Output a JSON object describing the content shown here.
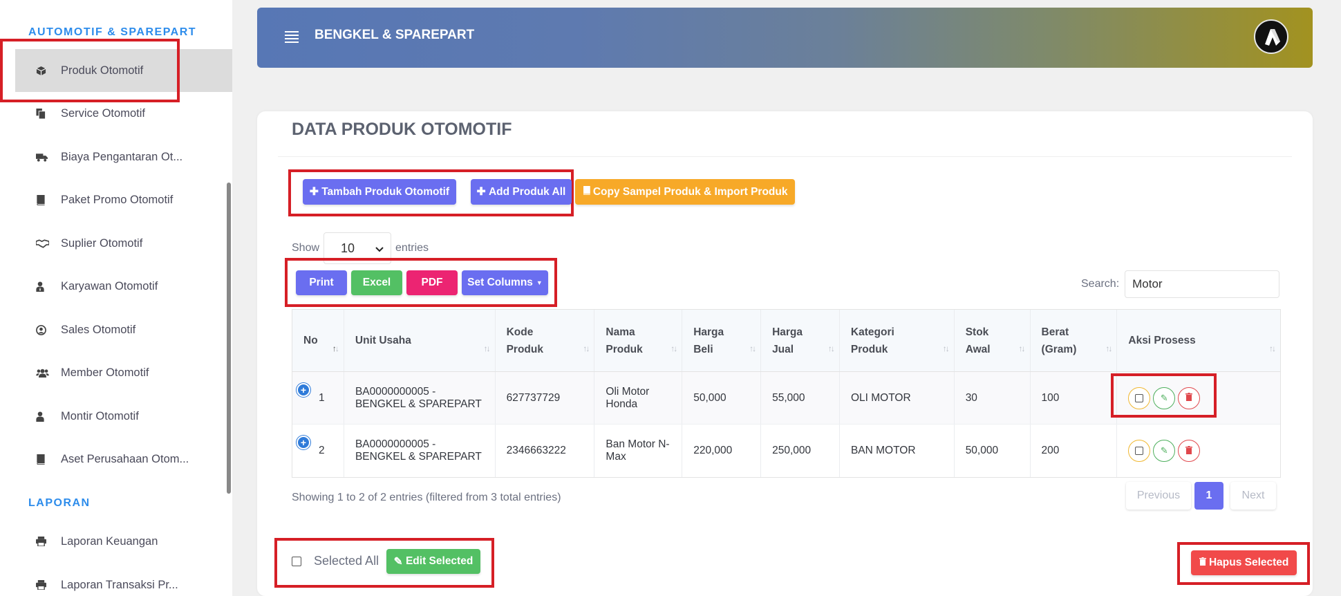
{
  "sidebar": {
    "section1": "AUTOMOTIF & SPAREPART",
    "items": [
      {
        "label": "Produk Otomotif",
        "icon": "box-icon"
      },
      {
        "label": "Service Otomotif",
        "icon": "copy-icon"
      },
      {
        "label": "Biaya Pengantaran Ot...",
        "icon": "truck-icon"
      },
      {
        "label": "Paket Promo Otomotif",
        "icon": "book-icon"
      },
      {
        "label": "Suplier Otomotif",
        "icon": "handshake-icon"
      },
      {
        "label": "Karyawan Otomotif",
        "icon": "user-tie-icon"
      },
      {
        "label": "Sales Otomotif",
        "icon": "user-circle-icon"
      },
      {
        "label": "Member Otomotif",
        "icon": "users-icon"
      },
      {
        "label": "Montir Otomotif",
        "icon": "user-icon"
      },
      {
        "label": "Aset Perusahaan Otom...",
        "icon": "book-icon"
      }
    ],
    "section2": "LAPORAN",
    "report_items": [
      {
        "label": "Laporan Keuangan",
        "icon": "print-icon"
      },
      {
        "label": "Laporan Transaksi Pr...",
        "icon": "print-icon"
      }
    ]
  },
  "header": {
    "brand": "BENGKEL & SPAREPART"
  },
  "page": {
    "title": "DATA PRODUK OTOMOTIF",
    "btn_tambah": "Tambah Produk Otomotif",
    "btn_add_all": "Add Produk All",
    "btn_copy": "Copy Sampel Produk & Import Produk",
    "show_label": "Show",
    "entries_value": "10",
    "entries_label": "entries",
    "btn_print": "Print",
    "btn_excel": "Excel",
    "btn_pdf": "PDF",
    "btn_columns": "Set Columns",
    "search_label": "Search:",
    "search_value": "Motor"
  },
  "table": {
    "headers": {
      "no": "No",
      "unit": "Unit Usaha",
      "kode1": "Kode",
      "kode2": "Produk",
      "nama1": "Nama",
      "nama2": "Produk",
      "beli1": "Harga",
      "beli2": "Beli",
      "jual1": "Harga",
      "jual2": "Jual",
      "kat1": "Kategori",
      "kat2": "Produk",
      "stok1": "Stok",
      "stok2": "Awal",
      "berat1": "Berat",
      "berat2": "(Gram)",
      "aksi": "Aksi Prosess"
    },
    "rows": [
      {
        "no": "1",
        "unit1": "BA0000000005 -",
        "unit2": "BENGKEL & SPAREPART",
        "kode": "627737729",
        "nama1": "Oli Motor",
        "nama2": "Honda",
        "beli": "50,000",
        "jual": "55,000",
        "kategori": "OLI MOTOR",
        "stok": "30",
        "berat": "100"
      },
      {
        "no": "2",
        "unit1": "BA0000000005 -",
        "unit2": "BENGKEL & SPAREPART",
        "kode": "2346663222",
        "nama1": "Ban Motor N-",
        "nama2": "Max",
        "beli": "220,000",
        "jual": "250,000",
        "kategori": "BAN MOTOR",
        "stok": "50,000",
        "berat": "200"
      }
    ]
  },
  "footer": {
    "info": "Showing 1 to 2 of 2 entries (filtered from 3 total entries)",
    "prev": "Previous",
    "page": "1",
    "next": "Next",
    "selected_all": "Selected All",
    "edit_selected": "Edit Selected",
    "hapus_selected": "Hapus Selected"
  }
}
